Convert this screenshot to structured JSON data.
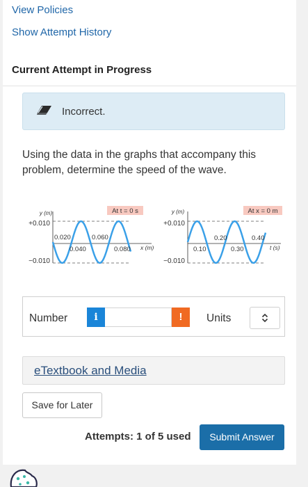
{
  "links": {
    "view_policies": "View Policies",
    "show_attempt_history": "Show Attempt History"
  },
  "section_title": "Current Attempt in Progress",
  "alert": {
    "message": "Incorrect."
  },
  "question": "Using the data in the graphs that accompany this problem, determine the speed of the wave.",
  "graphs": [
    {
      "label": "At t = 0 s",
      "y_axis_label": "y (m)",
      "x_axis_label": "x (m)",
      "y_top": "+0.010",
      "y_bottom": "−0.010",
      "ticks_above": [
        "0.020",
        "0.060"
      ],
      "ticks_below": [
        "0.040",
        "0.080"
      ]
    },
    {
      "label": "At x = 0 m",
      "y_axis_label": "y (m)",
      "x_axis_label": "t (s)",
      "y_top": "+0.010",
      "y_bottom": "−0.010",
      "ticks_above": [
        "0.20",
        "0.40"
      ],
      "ticks_below": [
        "0.10",
        "0.30"
      ]
    }
  ],
  "answer": {
    "number_label": "Number",
    "info_icon_label": "i",
    "warning_icon_label": "!",
    "number_value": "",
    "units_label": "Units",
    "units_value": ""
  },
  "etextbook": "eTextbook and Media",
  "save_label": "Save for Later",
  "attempts": "Attempts: 1 of 5 used",
  "submit_label": "Submit Answer",
  "colors": {
    "link": "#1f66a8",
    "alert_bg": "#ddecf5",
    "info_blue": "#1a85d8",
    "warning_orange": "#f06a22",
    "submit_blue": "#1b6ea8",
    "wave_blue": "#3aa0e8",
    "graph_label_bg": "#f8c9c0"
  }
}
